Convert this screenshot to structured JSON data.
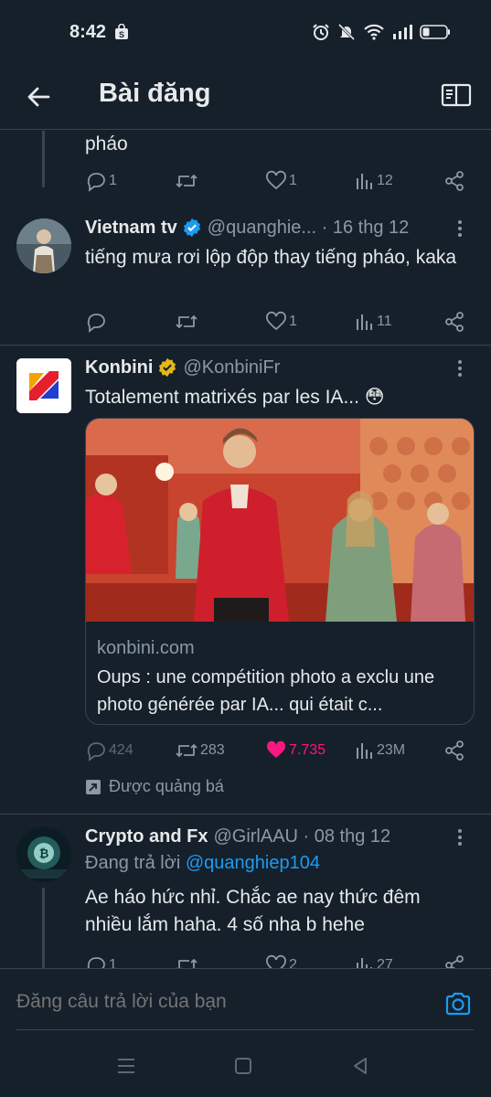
{
  "status": {
    "time": "8:42"
  },
  "header": {
    "title": "Bài đăng"
  },
  "tweet0": {
    "text_tail": "pháo",
    "replies": "1",
    "retweets": "",
    "likes": "1",
    "views": "12"
  },
  "tweet1": {
    "name": "Vietnam tv",
    "handle_date": "@quanghie... · 16 thg 12",
    "text": "tiếng mưa rơi lộp độp thay tiếng pháo, kaka",
    "replies": "",
    "retweets": "",
    "likes": "1",
    "views": "11"
  },
  "tweet2": {
    "name": "Konbini",
    "handle": "@KonbiniFr",
    "text": "Totalement matrixés par les IA... 😳",
    "card": {
      "domain": "konbini.com",
      "title": "Oups : une compétition photo a exclu une photo générée par IA... qui était c..."
    },
    "replies": "424",
    "retweets": "283",
    "likes": "7.735",
    "views": "23M",
    "promoted": "Được quảng bá"
  },
  "tweet3": {
    "name": "Crypto and Fx",
    "handle_date": "@GirlAAU · 08 thg 12",
    "reply_prefix": "Đang trả lời",
    "reply_mention": "@quanghiep104",
    "text": "Ae háo hức nhỉ. Chắc ae nay thức đêm nhiều lắm haha. 4 số nha b hehe",
    "replies": "1",
    "likes": "2",
    "views": "27"
  },
  "compose": {
    "placeholder": "Đăng câu trả lời của bạn"
  },
  "colors": {
    "background": "#15202b",
    "accent": "#1d9bf0",
    "muted": "#8b98a5",
    "like": "#f91880",
    "verified_gold": "#e2b719"
  },
  "icons": [
    "back-arrow-icon",
    "reader-icon",
    "reply-icon",
    "retweet-icon",
    "like-icon",
    "views-icon",
    "share-icon",
    "more-icon",
    "verified-icon",
    "promoted-icon",
    "camera-icon"
  ]
}
